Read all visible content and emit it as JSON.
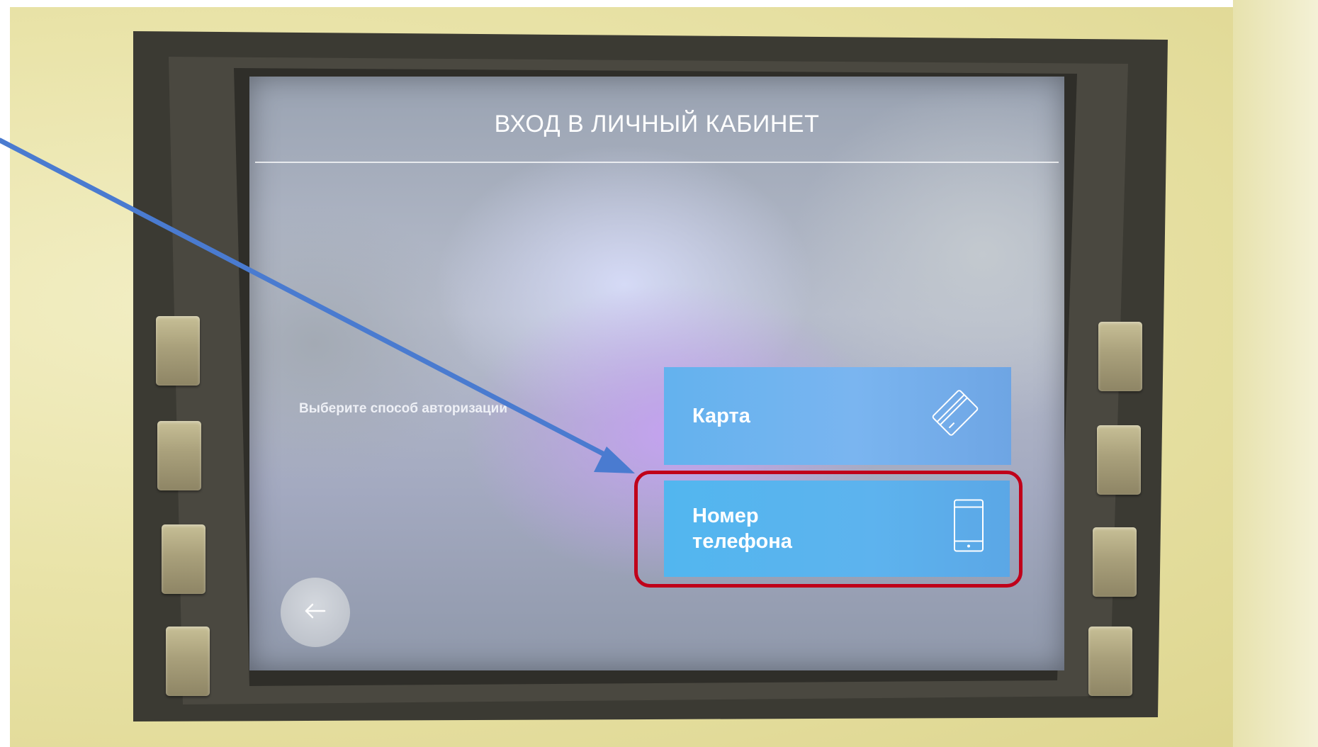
{
  "screen": {
    "title": "ВХОД В ЛИЧНЫЙ КАБИНЕТ",
    "prompt": "Выберите способ авторизации",
    "options": [
      {
        "label": "Карта",
        "icon": "card-icon"
      },
      {
        "label": "Номер телефона",
        "icon": "phone-icon"
      }
    ],
    "back_icon": "arrow-left-icon"
  },
  "annotation": {
    "highlight_color": "#c0001a",
    "arrow_color": "#4a7bd0",
    "highlighted_option": "Номер телефона"
  },
  "side_keys": {
    "left_count": 4,
    "right_count": 4
  }
}
